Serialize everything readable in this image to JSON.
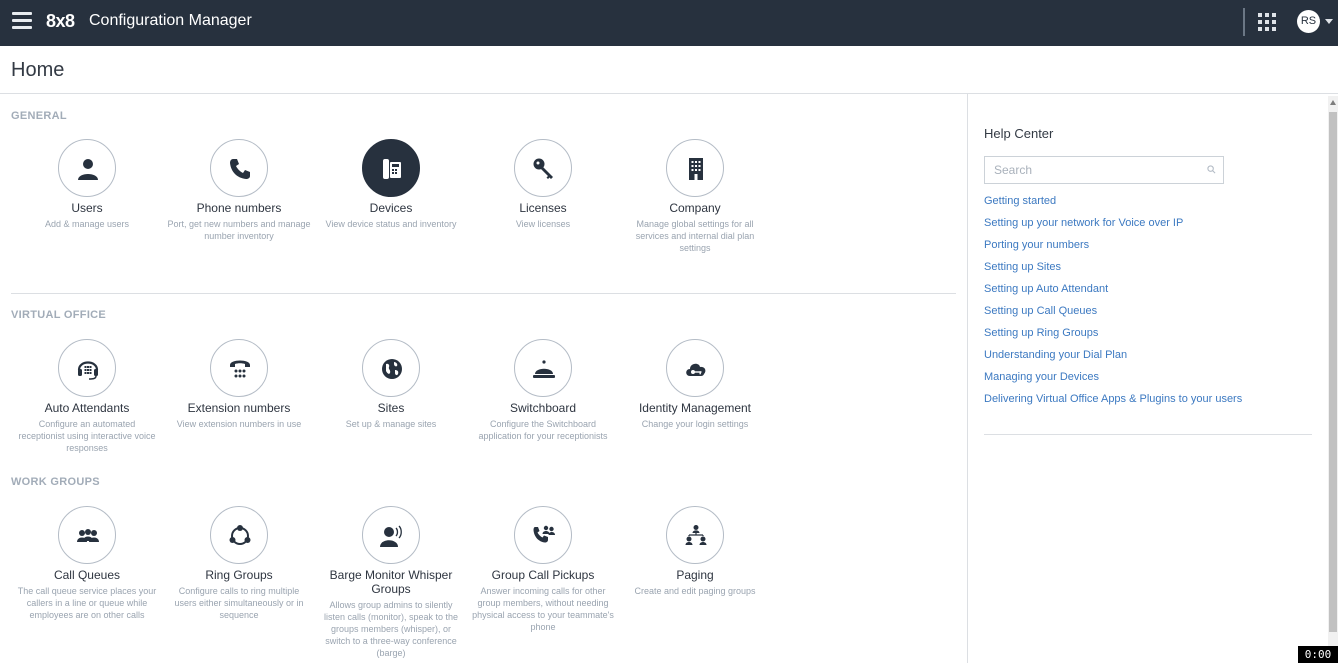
{
  "header": {
    "logo": "8x8",
    "app_title": "Configuration Manager",
    "menu_icon": "hamburger-icon",
    "apps_icon": "grid-icon",
    "avatar_initials": "RS"
  },
  "page": {
    "title": "Home"
  },
  "sections": {
    "general": {
      "title": "GENERAL",
      "tiles": [
        {
          "label": "Users",
          "desc": "Add & manage users",
          "icon": "user-icon"
        },
        {
          "label": "Phone numbers",
          "desc": "Port, get new numbers and manage number inventory",
          "icon": "phone-icon"
        },
        {
          "label": "Devices",
          "desc": "View device status and inventory",
          "icon": "desk-phone-icon"
        },
        {
          "label": "Licenses",
          "desc": "View licenses",
          "icon": "key-icon"
        },
        {
          "label": "Company",
          "desc": "Manage global settings for all services and internal dial plan settings",
          "icon": "building-icon"
        }
      ]
    },
    "virtual_office": {
      "title": "VIRTUAL OFFICE",
      "tiles": [
        {
          "label": "Auto Attendants",
          "desc": "Configure an automated receptionist using interactive voice responses",
          "icon": "headset-icon"
        },
        {
          "label": "Extension numbers",
          "desc": "View extension numbers in use",
          "icon": "dialpad-phone-icon"
        },
        {
          "label": "Sites",
          "desc": "Set up & manage sites",
          "icon": "globe-icon"
        },
        {
          "label": "Switchboard",
          "desc": "Configure the Switchboard application for your receptionists",
          "icon": "service-bell-icon"
        },
        {
          "label": "Identity Management",
          "desc": "Change your login settings",
          "icon": "cloud-key-icon"
        }
      ]
    },
    "work_groups": {
      "title": "WORK GROUPS",
      "tiles": [
        {
          "label": "Call Queues",
          "desc": "The call queue service places your callers in a line or queue while employees are on other calls",
          "icon": "queue-users-icon"
        },
        {
          "label": "Ring Groups",
          "desc": "Configure calls to ring multiple users either simultaneously or in sequence",
          "icon": "ring-group-icon"
        },
        {
          "label": "Barge Monitor Whisper Groups",
          "desc": "Allows group admins to silently listen calls (monitor), speak to the groups members (whisper), or switch to a three-way conference (barge)",
          "icon": "speaking-user-icon"
        },
        {
          "label": "Group Call Pickups",
          "desc": "Answer incoming calls for other group members, without needing physical access to your teammate's phone",
          "icon": "phone-users-icon"
        },
        {
          "label": "Paging",
          "desc": "Create and edit paging groups",
          "icon": "hierarchy-icon"
        }
      ]
    }
  },
  "help": {
    "title": "Help Center",
    "search_placeholder": "Search",
    "links": [
      "Getting started",
      "Setting up your network for Voice over IP",
      "Porting your numbers",
      "Setting up Sites",
      "Setting up Auto Attendant",
      "Setting up Call Queues",
      "Setting up Ring Groups",
      "Understanding your Dial Plan",
      "Managing your Devices",
      "Delivering Virtual Office Apps & Plugins to your users"
    ]
  },
  "timer": "0:00",
  "colors": {
    "topbar": "#27313e",
    "link": "#3c79c1",
    "section_title": "#a2acb8"
  }
}
